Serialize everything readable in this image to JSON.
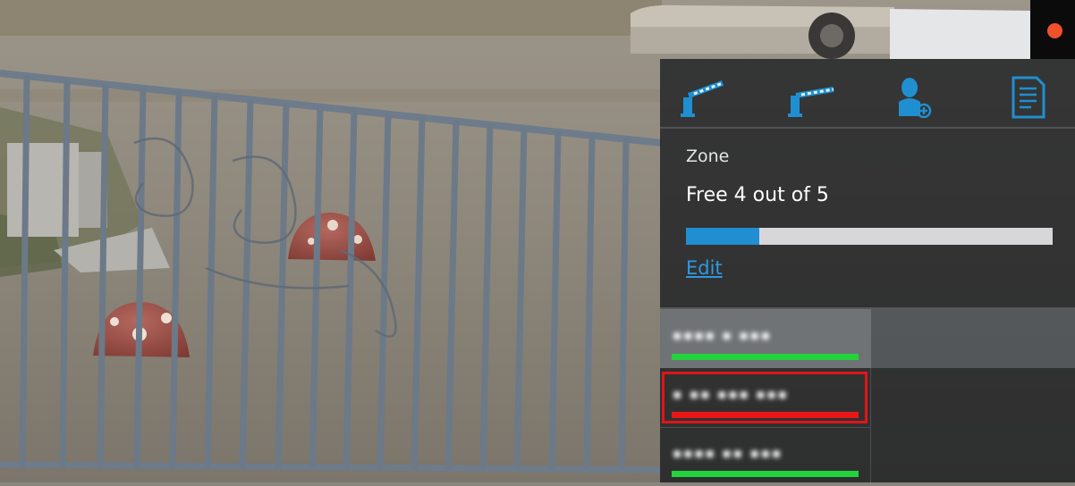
{
  "colors": {
    "accent": "#1f8fd1",
    "status_free": "#22d33c",
    "status_occupied": "#e81717",
    "status_dot": "#f0502a",
    "selection": "#e0141a"
  },
  "toolbar": {
    "icons": [
      "barrier-open-icon",
      "barrier-closed-icon",
      "add-person-icon",
      "document-icon"
    ]
  },
  "zone": {
    "label": "Zone",
    "status": "Free 4 out of 5",
    "free": 4,
    "total": 5,
    "occupancy_fraction": 0.2,
    "edit_label": "Edit"
  },
  "rows": [
    {
      "text": "▪▪▪▪ ▪ ▪▪▪",
      "status": "free"
    },
    {
      "text": "▪ ▪▪ ▪▪▪ ▪▪▪",
      "status": "occupied",
      "selected": true
    },
    {
      "text": "▪▪▪▪ ▪▪ ▪▪▪",
      "status": "free"
    }
  ]
}
